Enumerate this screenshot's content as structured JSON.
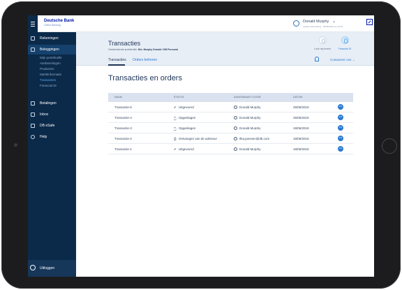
{
  "header": {
    "brand_name": "Deutsche Bank",
    "brand_sub": "Online Banking",
    "user_name": "Donald Murphy",
    "user_meta": "Laatste aanmelding · 05/06/2019 om 10:51",
    "chevron": "⌄"
  },
  "sidebar": {
    "items": [
      {
        "label": "Rekeningen",
        "icon": "card-icon"
      },
      {
        "label": "Beleggingen",
        "icon": "chart-icon"
      },
      {
        "label": "Betalingen",
        "icon": "payment-icon"
      },
      {
        "label": "Inbox",
        "icon": "mail-icon"
      },
      {
        "label": "DB eSafe",
        "icon": "safe-icon"
      },
      {
        "label": "Help",
        "icon": "help-icon"
      }
    ],
    "sub_items": [
      "Mijn portefeuille",
      "Aanbevelingen",
      "Producten",
      "Marktinformatie",
      "Transacties",
      "Financial ID"
    ],
    "selected_sub": "Transacties",
    "logout_label": "Uitloggen"
  },
  "page": {
    "title": "Transacties",
    "subtitle_prefix": "Geselecteerde portefeuille:",
    "subtitle_value": "Dhr. Murphy Donald / DB Personal",
    "buttons": [
      {
        "label": "Lock my Invest",
        "active": false
      },
      {
        "label": "Financial ID",
        "active": true
      }
    ],
    "tabs": [
      {
        "label": "Transacties",
        "active": true
      },
      {
        "label": "Orders beheren",
        "active": false
      }
    ],
    "contact_label": "Contacteer ons ⌄"
  },
  "main": {
    "section_title": "Transacties en orders",
    "columns": [
      "NAAM",
      "STATUS",
      "AANGEMAAKT DOOR",
      "DATUM"
    ],
    "rows": [
      {
        "name": "Transactie-5",
        "status_icon": "✔",
        "status": "Uitgevoerd",
        "by": "Donald Murphy",
        "date": "25/06/2019"
      },
      {
        "name": "Transactie-4",
        "status_icon": "🗋",
        "status": "Opgeslagen",
        "by": "Donald Murphy",
        "date": "25/06/2019"
      },
      {
        "name": "Transactie-3",
        "status_icon": "🗋",
        "status": "Opgeslagen",
        "by": "Donald Murphy",
        "date": "19/06/2019"
      },
      {
        "name": "Transactie-2",
        "status_icon": "⎙",
        "status": "Ontvangen van de adviseur",
        "by": "Ilka.janssen@db.com",
        "date": "19/06/2019"
      },
      {
        "name": "Transactie-1",
        "status_icon": "✔",
        "status": "Uitgevoerd",
        "by": "Donald Murphy",
        "date": "18/06/2019"
      }
    ],
    "more_glyph": "•••"
  },
  "colors": {
    "sidebar": "#0b2a4a",
    "accent": "#2b7ad0",
    "title": "#1d3557",
    "header_bg": "#e8eef6"
  }
}
